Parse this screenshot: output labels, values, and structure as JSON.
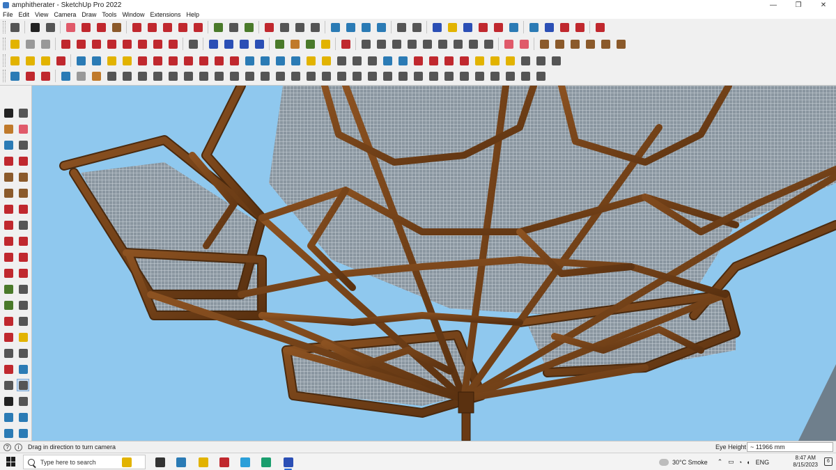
{
  "window": {
    "title": "amphitherater - SketchUp Pro 2022",
    "minimize": "—",
    "maximize": "❐",
    "close": "✕"
  },
  "menu": [
    "File",
    "Edit",
    "View",
    "Camera",
    "Draw",
    "Tools",
    "Window",
    "Extensions",
    "Help"
  ],
  "colors": {
    "sky": "#8fc8ee",
    "wood": "#7a4519",
    "wood_dark": "#4b2a0e",
    "wood_light": "#9a5c28",
    "mesh": "#a8b3bd"
  },
  "status": {
    "hint": "Drag in direction to turn camera",
    "vcb_label": "Eye Height",
    "vcb_value": "~ 11966 mm"
  },
  "taskbar": {
    "search_placeholder": "Type here to search",
    "weather": "30°C  Smoke",
    "language": "ENG",
    "time": "8:47 AM",
    "date": "8/15/2023",
    "notification_count": "6",
    "apps": [
      "file-explorer",
      "task-view",
      "calculator",
      "folder",
      "autocad",
      "app-store",
      "edge",
      "sketchup"
    ]
  },
  "tools": {
    "active_left_tool": "look-around-icon"
  }
}
